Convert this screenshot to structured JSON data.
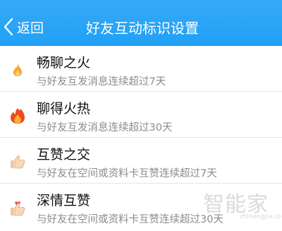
{
  "header": {
    "back_label": "返回",
    "title": "好友互动标识设置",
    "bg_color": "#20a0f5"
  },
  "items": [
    {
      "name": "畅聊之火",
      "desc": "与好友互发消息连续超过7天",
      "icon": "small-flame-icon"
    },
    {
      "name": "聊得火热",
      "desc": "与好友互发消息连续超过30天",
      "icon": "big-flame-icon"
    },
    {
      "name": "互赞之交",
      "desc": "与好友在空间或资料卡互赞连续超过7天",
      "icon": "thumbs-up-icon"
    },
    {
      "name": "深情互赞",
      "desc": "与好友在空间或资料卡互赞连续超过30天",
      "icon": "thumbs-up-heart-icon"
    }
  ],
  "watermark": {
    "text": "智能家",
    "sub": "zhinengjia.com"
  }
}
